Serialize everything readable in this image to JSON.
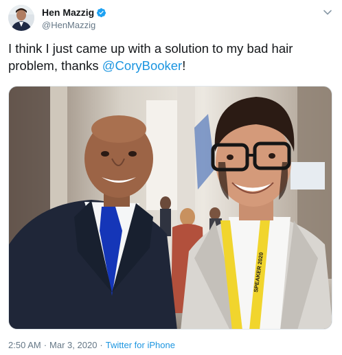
{
  "author": {
    "display_name": "Hen Mazzig",
    "handle": "@HenMazzig",
    "verified_icon": "verified-badge-icon",
    "accent": "#1da1f2"
  },
  "menu_icon": "chevron-down-icon",
  "tweet": {
    "text_before": "I think I just came up with a solution to my bad hair problem, thanks ",
    "mention": "@CoryBooker",
    "text_after": "!",
    "mention_color": "#1b95e0"
  },
  "photo": {
    "lanyard_text": "SPEAKER 2020"
  },
  "meta": {
    "time": "2:50 AM",
    "date": "Mar 3, 2020",
    "separator": "·",
    "source": "Twitter for iPhone"
  }
}
